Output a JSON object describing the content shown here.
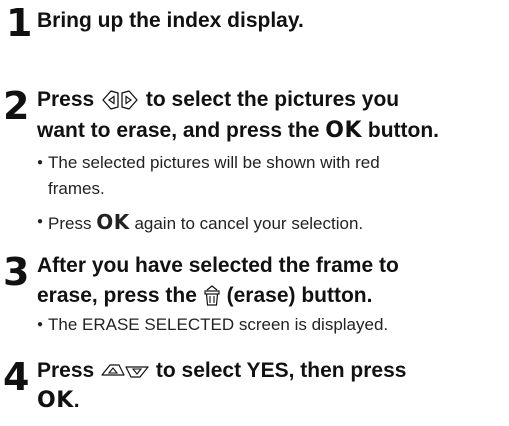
{
  "steps": [
    {
      "number": "1",
      "text": "Bring up the index display."
    },
    {
      "number": "2",
      "line1_a": "Press",
      "line1_b": "to select the pictures you",
      "line2_a": "want to erase, and press the",
      "line2_ok": "OK",
      "line2_b": "button.",
      "icon": "left-right-arrow-buttons-icon",
      "bullets": [
        {
          "line1": "The selected pictures will be shown with red",
          "line2": "frames."
        },
        {
          "a": "Press",
          "ok": "OK",
          "b": "again to cancel your selection."
        }
      ]
    },
    {
      "number": "3",
      "line1": "After you have selected the frame to",
      "line2_a": "erase, press the",
      "line2_b": "(erase) button.",
      "icon": "trash-erase-icon",
      "bullets": [
        "The ERASE SELECTED screen is displayed."
      ]
    },
    {
      "number": "4",
      "line1_a": "Press",
      "line1_b": "to select YES, then press",
      "line2_ok": "OK",
      "line2_b": ".",
      "icon": "up-down-arrow-buttons-icon"
    }
  ]
}
